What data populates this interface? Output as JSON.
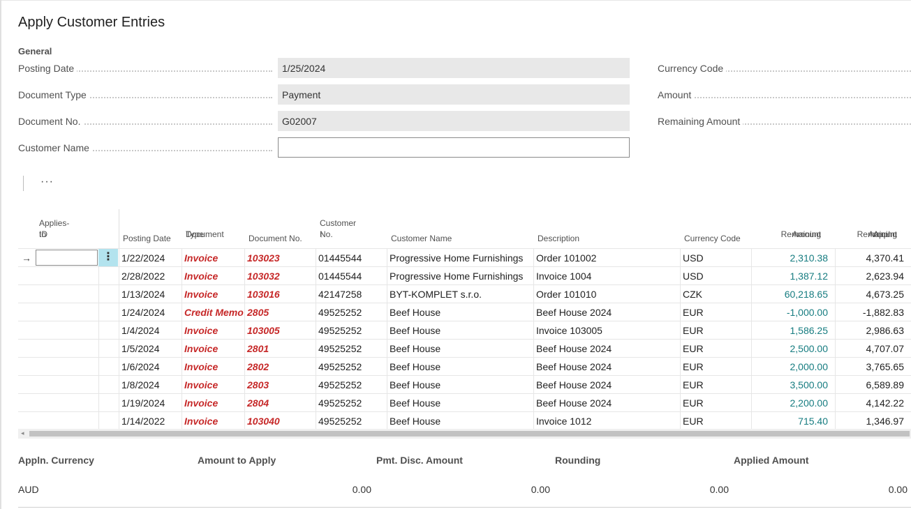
{
  "page": {
    "title": "Apply Customer Entries"
  },
  "general": {
    "section_label": "General",
    "posting_date": {
      "label": "Posting Date",
      "value": "1/25/2024"
    },
    "document_type": {
      "label": "Document Type",
      "value": "Payment"
    },
    "document_no": {
      "label": "Document No.",
      "value": "G02007"
    },
    "customer_name": {
      "label": "Customer Name",
      "value": ""
    },
    "currency_code": {
      "label": "Currency Code",
      "value": ""
    },
    "amount": {
      "label": "Amount",
      "value": ""
    },
    "remaining_amount": {
      "label": "Remaining Amount",
      "value": ""
    }
  },
  "actionbar": {
    "more_label": "···"
  },
  "grid": {
    "headers": {
      "applies_to_id": [
        "Applies-to",
        "ID"
      ],
      "posting_date": [
        "Posting Date"
      ],
      "document_type": [
        "Document",
        "Type"
      ],
      "document_no": [
        "Document No."
      ],
      "customer_no": [
        "Customer No.",
        "↑"
      ],
      "customer_name": [
        "Customer Name"
      ],
      "description": [
        "Description"
      ],
      "currency_code": [
        "Currency Code"
      ],
      "remaining_amount": [
        "Remaining",
        "Amount"
      ],
      "appln_remaining_amount": [
        "Appln.",
        "Remaining",
        "Amount"
      ]
    },
    "selected_row_marker": "→",
    "row_action_glyph": "⋮",
    "rows": [
      {
        "posting_date": "1/22/2024",
        "document_type": "Invoice",
        "document_no": "103023",
        "customer_no": "01445544",
        "customer_name": "Progressive Home Furnishings",
        "description": "Order 101002",
        "currency_code": "USD",
        "remaining_amount": "2,310.38",
        "appln_remaining_amount": "4,370.41"
      },
      {
        "posting_date": "2/28/2022",
        "document_type": "Invoice",
        "document_no": "103032",
        "customer_no": "01445544",
        "customer_name": "Progressive Home Furnishings",
        "description": "Invoice 1004",
        "currency_code": "USD",
        "remaining_amount": "1,387.12",
        "appln_remaining_amount": "2,623.94"
      },
      {
        "posting_date": "1/13/2024",
        "document_type": "Invoice",
        "document_no": "103016",
        "customer_no": "42147258",
        "customer_name": "BYT-KOMPLET s.r.o.",
        "description": "Order 101010",
        "currency_code": "CZK",
        "remaining_amount": "60,218.65",
        "appln_remaining_amount": "4,673.25"
      },
      {
        "posting_date": "1/24/2024",
        "document_type": "Credit Memo",
        "document_no": "2805",
        "customer_no": "49525252",
        "customer_name": "Beef House",
        "description": "Beef House 2024",
        "currency_code": "EUR",
        "remaining_amount": "-1,000.00",
        "appln_remaining_amount": "-1,882.83"
      },
      {
        "posting_date": "1/4/2024",
        "document_type": "Invoice",
        "document_no": "103005",
        "customer_no": "49525252",
        "customer_name": "Beef House",
        "description": "Invoice 103005",
        "currency_code": "EUR",
        "remaining_amount": "1,586.25",
        "appln_remaining_amount": "2,986.63"
      },
      {
        "posting_date": "1/5/2024",
        "document_type": "Invoice",
        "document_no": "2801",
        "customer_no": "49525252",
        "customer_name": "Beef House",
        "description": "Beef House 2024",
        "currency_code": "EUR",
        "remaining_amount": "2,500.00",
        "appln_remaining_amount": "4,707.07"
      },
      {
        "posting_date": "1/6/2024",
        "document_type": "Invoice",
        "document_no": "2802",
        "customer_no": "49525252",
        "customer_name": "Beef House",
        "description": "Beef House 2024",
        "currency_code": "EUR",
        "remaining_amount": "2,000.00",
        "appln_remaining_amount": "3,765.65"
      },
      {
        "posting_date": "1/8/2024",
        "document_type": "Invoice",
        "document_no": "2803",
        "customer_no": "49525252",
        "customer_name": "Beef House",
        "description": "Beef House 2024",
        "currency_code": "EUR",
        "remaining_amount": "3,500.00",
        "appln_remaining_amount": "6,589.89"
      },
      {
        "posting_date": "1/19/2024",
        "document_type": "Invoice",
        "document_no": "2804",
        "customer_no": "49525252",
        "customer_name": "Beef House",
        "description": "Beef House 2024",
        "currency_code": "EUR",
        "remaining_amount": "2,200.00",
        "appln_remaining_amount": "4,142.22"
      },
      {
        "posting_date": "1/14/2022",
        "document_type": "Invoice",
        "document_no": "103040",
        "customer_no": "49525252",
        "customer_name": "Beef House",
        "description": "Invoice 1012",
        "currency_code": "EUR",
        "remaining_amount": "715.40",
        "appln_remaining_amount": "1,346.97"
      }
    ]
  },
  "footer": {
    "appln_currency": {
      "label": "Appln. Currency",
      "value": "AUD"
    },
    "amount_to_apply": {
      "label": "Amount to Apply",
      "value": "0.00"
    },
    "pmt_disc_amount": {
      "label": "Pmt. Disc. Amount",
      "value": "0.00"
    },
    "rounding": {
      "label": "Rounding",
      "value": "0.00"
    },
    "applied_amount": {
      "label": "Applied Amount",
      "value": "0.00"
    }
  },
  "colors": {
    "red_text": "#c62828",
    "teal_text": "#167c80",
    "row_action_bg": "#b3e3ee",
    "readonly_field_bg": "#e8e8e8"
  }
}
